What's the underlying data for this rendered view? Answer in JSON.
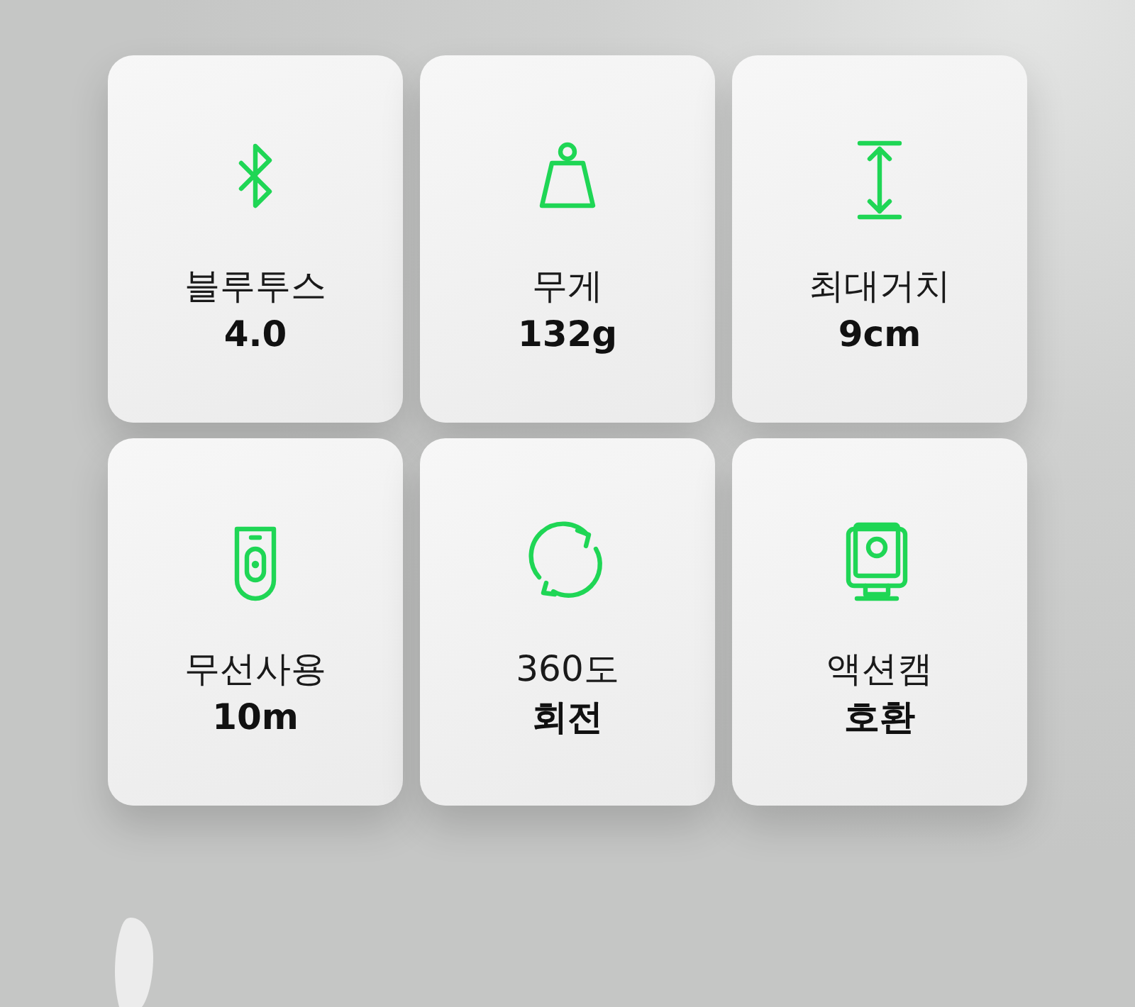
{
  "specs": [
    {
      "kind": "bluetooth",
      "label": "블루투스",
      "value": "4.0"
    },
    {
      "kind": "weight",
      "label": "무게",
      "value": "132g"
    },
    {
      "kind": "height",
      "label": "최대거치",
      "value": "9cm"
    },
    {
      "kind": "remote",
      "label": "무선사용",
      "value": "10m"
    },
    {
      "kind": "rotate",
      "label": "360도",
      "value": "회전"
    },
    {
      "kind": "camera",
      "label": "액션캠",
      "value": "호환"
    }
  ]
}
